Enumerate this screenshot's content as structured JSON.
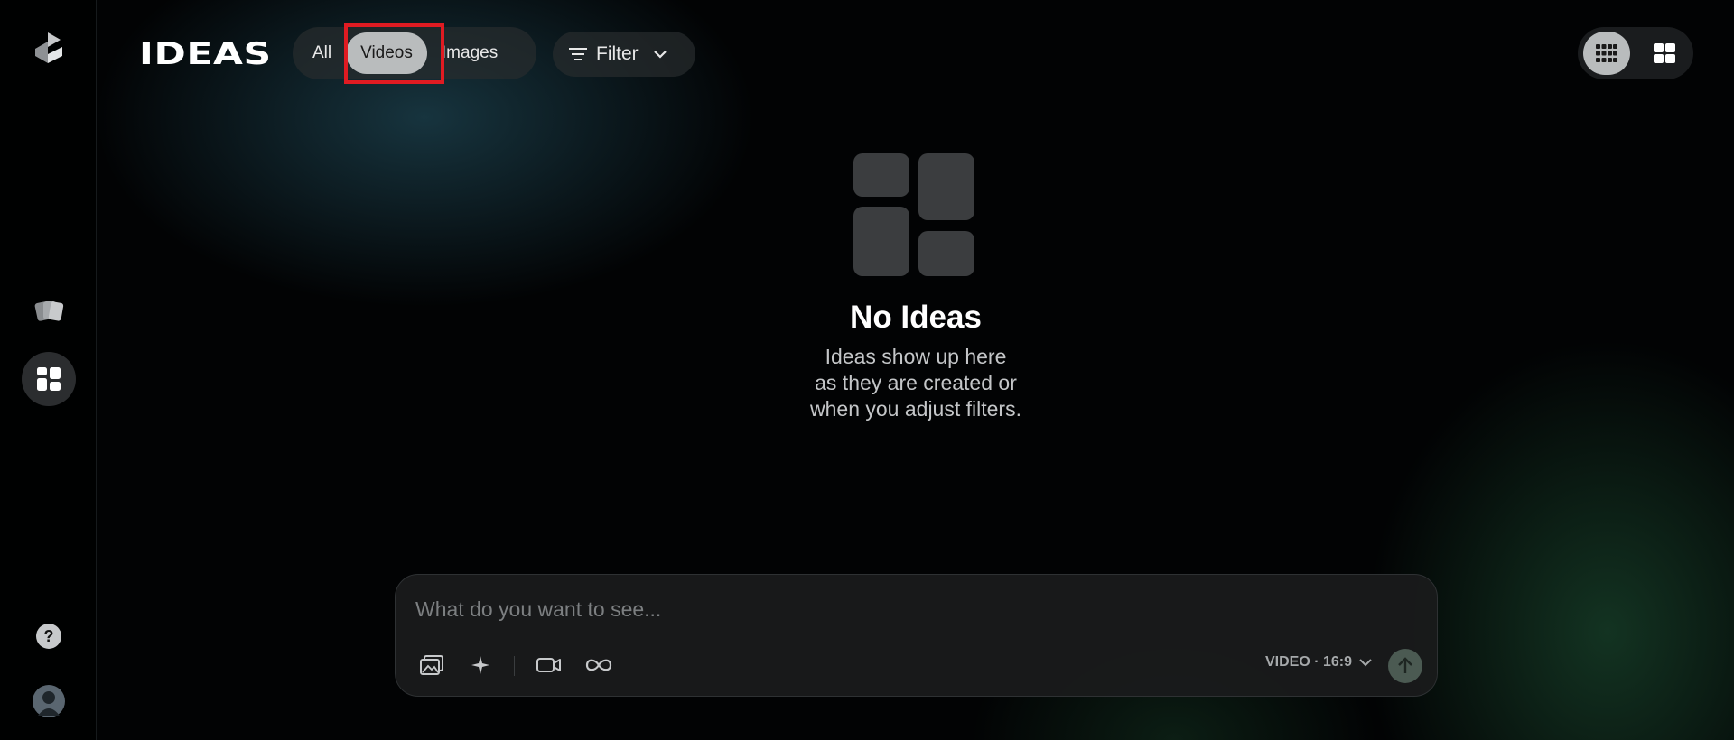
{
  "header": {
    "title": "IDEAS",
    "tabs": [
      {
        "label": "All",
        "active": false
      },
      {
        "label": "Videos",
        "active": true
      },
      {
        "label": "Images",
        "active": false
      }
    ],
    "filter_label": "Filter"
  },
  "sidebar": {
    "items": [
      {
        "icon": "logo-icon"
      },
      {
        "icon": "boards-icon"
      },
      {
        "icon": "ideas-grid-icon",
        "active": true
      },
      {
        "icon": "help-icon"
      },
      {
        "icon": "avatar"
      }
    ]
  },
  "view_toggle": {
    "options": [
      {
        "icon": "dense-grid-icon",
        "active": true
      },
      {
        "icon": "large-grid-icon",
        "active": false
      }
    ]
  },
  "empty_state": {
    "title": "No Ideas",
    "lines": [
      "Ideas show up here",
      "as they are created or",
      "when you adjust filters."
    ]
  },
  "prompt": {
    "placeholder": "What do you want to see...",
    "mode_label": "VIDEO · 16:9",
    "tools": [
      "image-upload-icon",
      "sparkle-icon",
      "video-camera-icon",
      "infinity-icon"
    ]
  },
  "colors": {
    "accent_active": "#b9bcbd",
    "highlight_box": "#e01b22",
    "send_button": "#4b5a52"
  }
}
